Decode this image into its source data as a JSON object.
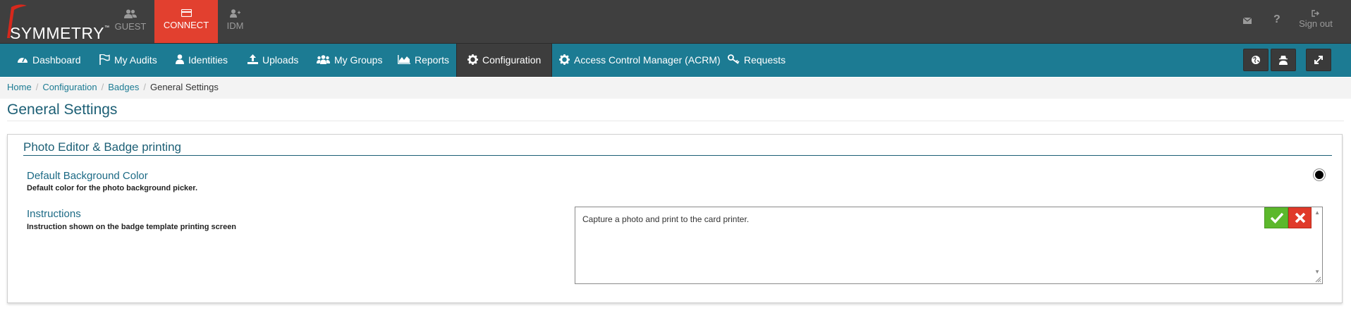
{
  "brand": {
    "name": "SYMMETRY",
    "tm": "™"
  },
  "app_tabs": [
    {
      "label": "GUEST",
      "icon": "users-icon",
      "active": false
    },
    {
      "label": "CONNECT",
      "icon": "card-icon",
      "active": true
    },
    {
      "label": "IDM",
      "icon": "user-plus-icon",
      "active": false
    }
  ],
  "header_right": {
    "help": "?",
    "signout_label": "Sign out"
  },
  "nav": {
    "items": [
      {
        "label": "Dashboard",
        "icon": "dashboard-icon"
      },
      {
        "label": "My Audits",
        "icon": "flag-icon"
      },
      {
        "label": "Identities",
        "icon": "user-icon"
      },
      {
        "label": "Uploads",
        "icon": "upload-icon"
      },
      {
        "label": "My Groups",
        "icon": "group-icon"
      },
      {
        "label": "Reports",
        "icon": "area-chart-icon"
      },
      {
        "label": "Configuration",
        "icon": "gear-icon",
        "active": true
      },
      {
        "label": "Access Control Manager (ACRM)",
        "icon": "gear-icon"
      },
      {
        "label": "Requests",
        "icon": "key-icon"
      }
    ]
  },
  "breadcrumb": {
    "home": "Home",
    "configuration": "Configuration",
    "badges": "Badges",
    "current": "General Settings",
    "separator": "/"
  },
  "page": {
    "title": "General Settings"
  },
  "panel": {
    "title": "Photo Editor & Badge printing",
    "settings": {
      "bg_color": {
        "label": "Default Background Color",
        "description": "Default color for the photo background picker.",
        "value_color": "#000000"
      },
      "instructions": {
        "label": "Instructions",
        "description": "Instruction shown on the badge template printing screen",
        "value": "Capture a photo and print to the card printer."
      }
    }
  },
  "colors": {
    "topbar": "#3f3f3f",
    "nav": "#1c7b93",
    "accent": "#e2402f",
    "ok": "#5cb82c",
    "cancel": "#e03a2a"
  }
}
